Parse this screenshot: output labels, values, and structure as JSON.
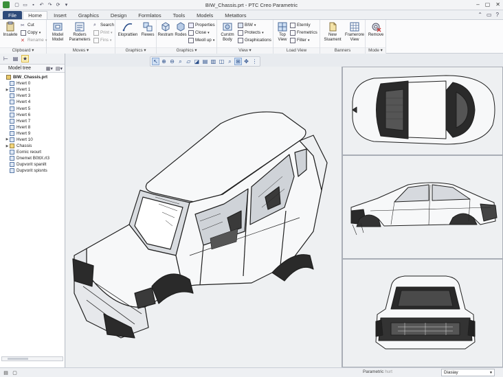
{
  "window": {
    "title": "BIW_Chassis.prt - PTC Creo Parametric"
  },
  "tabs": [
    "File",
    "Home",
    "Insert",
    "Graphics",
    "Design",
    "Formlatos",
    "Tools",
    "Models",
    "Metattors"
  ],
  "ribbon": {
    "clipboard": {
      "label": "Clipboard",
      "insert": "Insalete",
      "cut": "Cut",
      "copy": "Copy",
      "rename": "Rename"
    },
    "moves": {
      "label": "Moves",
      "model": "Model\nModel",
      "roders": "Roders\nParameters",
      "search": "Search",
      "print": "Print",
      "fins": "Fins"
    },
    "graphics1": {
      "label": "Graphics",
      "eloprattien": "Eloprattien",
      "flewes": "Flewes"
    },
    "graphics2": {
      "label": "Graphics",
      "restram": "Restram",
      "rodes": "Rodes",
      "properties": "Properties",
      "close": "Close",
      "meoll_up": "Meoll up"
    },
    "view": {
      "label": "View",
      "curstm": "Curstm\nBody",
      "biw": "BIW",
      "protects": "Protects",
      "graphications": "Graphications"
    },
    "load_view": {
      "label": "Load View",
      "top_view": "Top\nView",
      "eternly": "Eternly",
      "fremetrics": "Fremetrics",
      "filter": "Filter"
    },
    "banners": {
      "label": "Banners",
      "new": "New\nSluament",
      "framework": "Framerore\nView"
    },
    "mode": {
      "label": "Mode",
      "remove": "Remove"
    }
  },
  "model_tree": {
    "header": "Model tree",
    "items": [
      {
        "label": "BIW_Chassis.prt",
        "level": 0,
        "expandable": false,
        "bold": true
      },
      {
        "label": "Hvert 0",
        "level": 1,
        "expandable": false
      },
      {
        "label": "Hvert 1",
        "level": 1,
        "expandable": true
      },
      {
        "label": "Hvert 3",
        "level": 1,
        "expandable": false
      },
      {
        "label": "Hvert 4",
        "level": 1,
        "expandable": false
      },
      {
        "label": "Hvert 5",
        "level": 1,
        "expandable": false
      },
      {
        "label": "Hvert 6",
        "level": 1,
        "expandable": false
      },
      {
        "label": "Hvert 7",
        "level": 1,
        "expandable": false
      },
      {
        "label": "Hvert 8",
        "level": 1,
        "expandable": false
      },
      {
        "label": "Hvert 9",
        "level": 1,
        "expandable": false
      },
      {
        "label": "Hvert 10",
        "level": 1,
        "expandable": true
      },
      {
        "label": "Chassis",
        "level": 1,
        "expandable": true
      },
      {
        "label": "Eornic reourt",
        "level": 1,
        "expandable": false
      },
      {
        "label": "Dnemet B0ttX.rl3",
        "level": 1,
        "expandable": false
      },
      {
        "label": "Dupvorit spanilt",
        "level": 1,
        "expandable": false
      },
      {
        "label": "Dupvorit spisnts",
        "level": 1,
        "expandable": false
      }
    ]
  },
  "status": {
    "parametric": "Parametric",
    "hurt": "hurt",
    "selector": "Diasiay"
  },
  "colors": {
    "file_tab": "#2d4a7a",
    "accent": "#2a4e8a",
    "viewport_bg": "#eef0f2"
  }
}
